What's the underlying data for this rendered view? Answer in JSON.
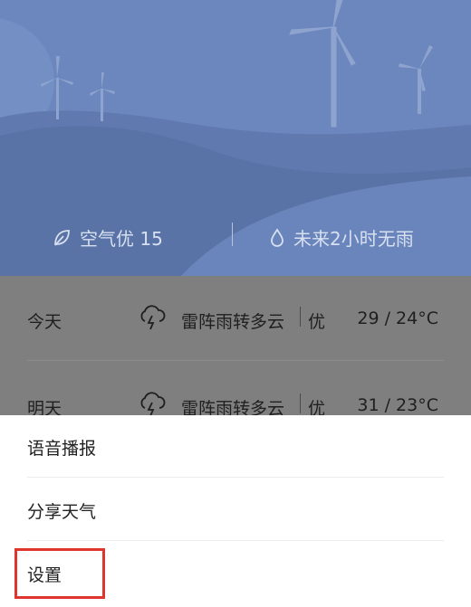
{
  "hero": {
    "air_quality": "空气优 15",
    "rain_forecast": "未来2小时无雨",
    "colors": {
      "sky": "#6b86bb",
      "hill_back": "#7a95c8",
      "hill_front": "#5f79ad"
    }
  },
  "forecast": {
    "rows": [
      {
        "day": "今天",
        "icon": "thunderstorm-icon",
        "condition": "雷阵雨转多云",
        "aqi": "优",
        "temp": "29 / 24°C"
      },
      {
        "day": "明天",
        "icon": "thunderstorm-icon",
        "condition": "雷阵雨转多云",
        "aqi": "优",
        "temp": "31 / 23°C"
      }
    ]
  },
  "menu": {
    "items": [
      {
        "label": "语音播报"
      },
      {
        "label": "分享天气"
      },
      {
        "label": "设置"
      }
    ],
    "highlight_color": "#e0342e"
  }
}
